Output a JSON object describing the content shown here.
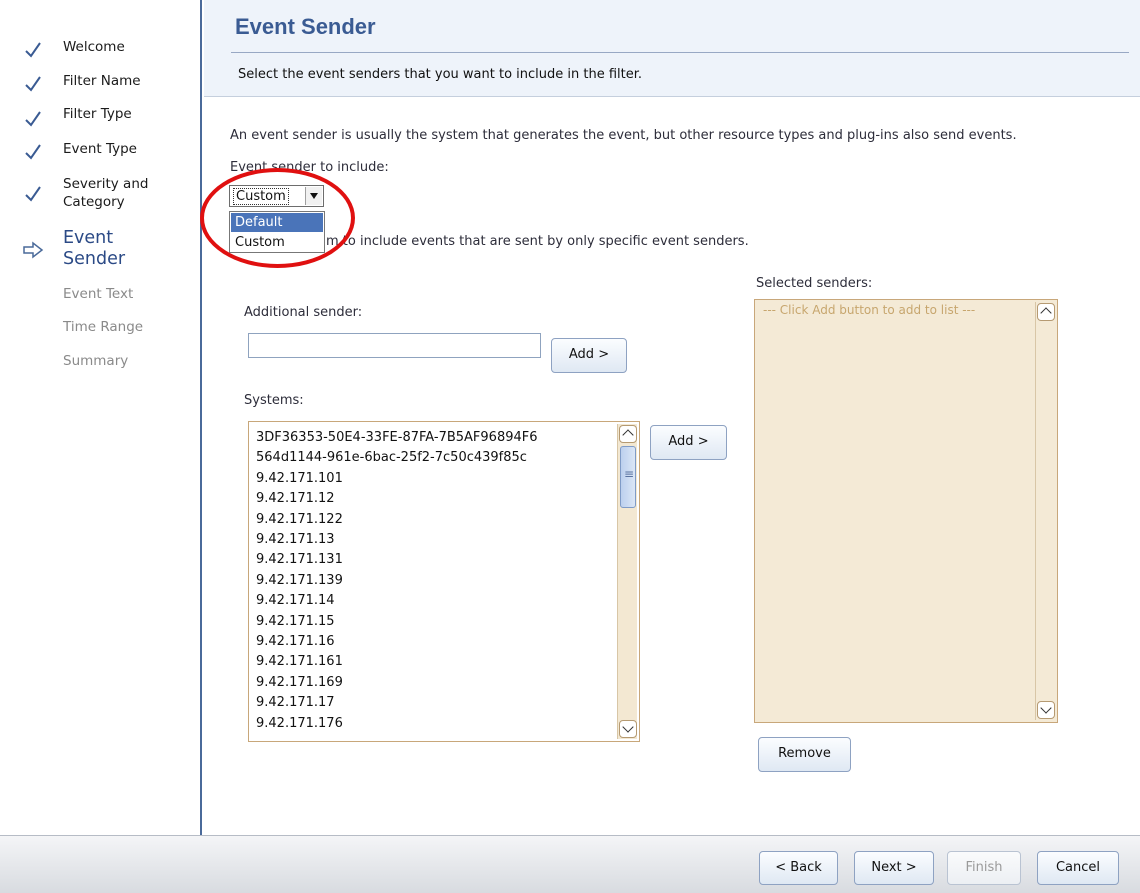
{
  "nav": {
    "items": [
      {
        "label": "Welcome",
        "state": "done"
      },
      {
        "label": "Filter Name",
        "state": "done"
      },
      {
        "label": "Filter Type",
        "state": "done"
      },
      {
        "label": "Event Type",
        "state": "done"
      },
      {
        "label_line1": "Severity and",
        "label_line2": "Category",
        "state": "done"
      },
      {
        "label_line1": "Event",
        "label_line2": "Sender",
        "state": "current"
      },
      {
        "label": "Event Text",
        "state": "pending"
      },
      {
        "label": "Time Range",
        "state": "pending"
      },
      {
        "label": "Summary",
        "state": "pending"
      }
    ]
  },
  "header": {
    "title": "Event Sender",
    "subtitle": "Select the event senders that you want to include in the filter."
  },
  "main": {
    "description": "An event sender is usually the system that generates the event, but other resource types and plug-ins also send events.",
    "include_label": "Event sender to include:",
    "select": {
      "value": "Custom",
      "options": [
        "Default",
        "Custom"
      ],
      "highlighted": "Default"
    },
    "hint_text": "m to include events that are sent by only specific event senders.",
    "additional_sender_label": "Additional sender:",
    "additional_sender_value": "",
    "add_button_1": "Add >",
    "systems_label": "Systems:",
    "systems": [
      "3DF36353-50E4-33FE-87FA-7B5AF96894F6",
      "564d1144-961e-6bac-25f2-7c50c439f85c",
      "9.42.171.101",
      "9.42.171.12",
      "9.42.171.122",
      "9.42.171.13",
      "9.42.171.131",
      "9.42.171.139",
      "9.42.171.14",
      "9.42.171.15",
      "9.42.171.16",
      "9.42.171.161",
      "9.42.171.169",
      "9.42.171.17",
      "9.42.171.176"
    ],
    "add_button_2": "Add >",
    "selected_senders_label": "Selected senders:",
    "selected_placeholder": "--- Click Add button to add to list ---",
    "remove_button": "Remove"
  },
  "footer": {
    "back": "< Back",
    "next": "Next >",
    "finish": "Finish",
    "cancel": "Cancel"
  },
  "colors": {
    "title": "#3a5b93",
    "highlight_circle": "#e01010",
    "selection": "#4a74b9"
  }
}
